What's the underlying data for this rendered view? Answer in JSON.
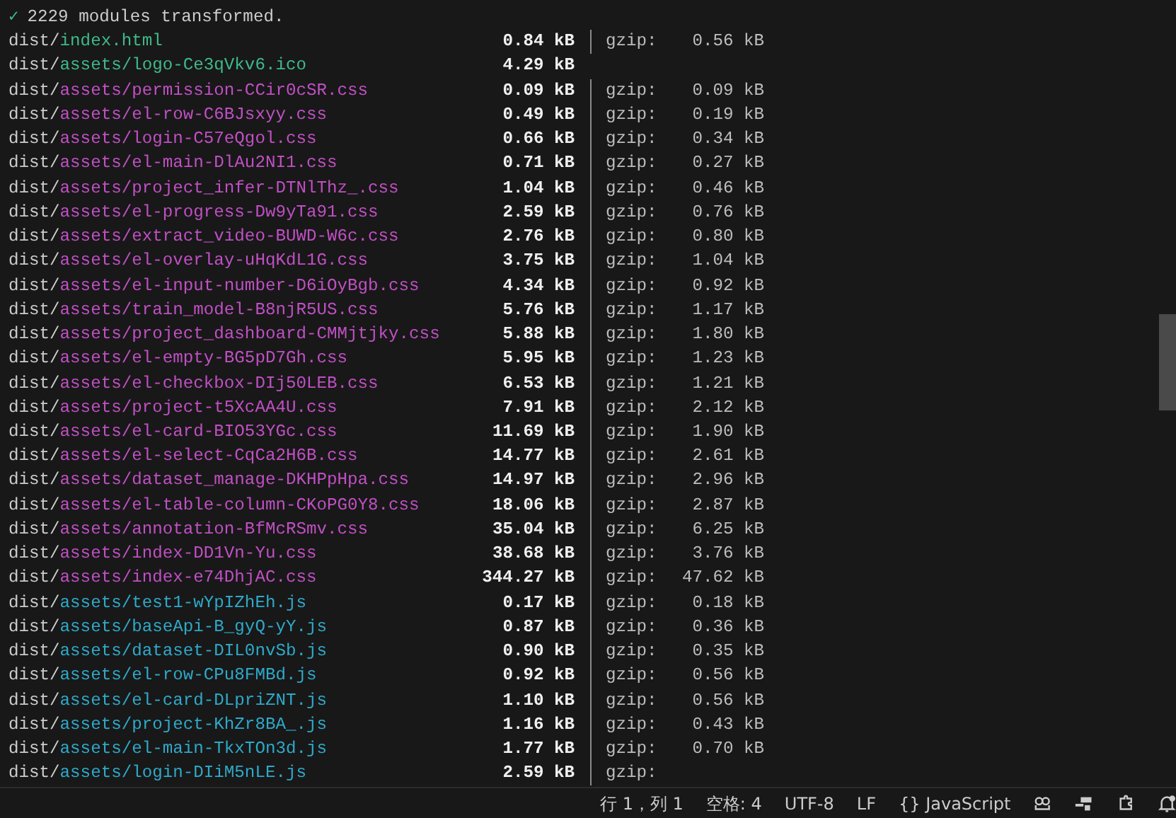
{
  "terminal": {
    "summary": {
      "check": "✓",
      "text": "2229 modules transformed."
    },
    "rows": [
      {
        "dir": "dist/",
        "file": "index.html",
        "kind": "html",
        "size": "0.84 kB",
        "gzip_label": "gzip:",
        "gzip": "0.56 kB"
      },
      {
        "dir": "dist/",
        "file": "assets/logo-Ce3qVkv6.ico",
        "kind": "ico",
        "size": "4.29 kB"
      },
      {
        "dir": "dist/",
        "file": "assets/permission-CCir0cSR.css",
        "kind": "css",
        "size": "0.09 kB",
        "gzip_label": "gzip:",
        "gzip": "0.09 kB"
      },
      {
        "dir": "dist/",
        "file": "assets/el-row-C6BJsxyy.css",
        "kind": "css",
        "size": "0.49 kB",
        "gzip_label": "gzip:",
        "gzip": "0.19 kB"
      },
      {
        "dir": "dist/",
        "file": "assets/login-C57eQgol.css",
        "kind": "css",
        "size": "0.66 kB",
        "gzip_label": "gzip:",
        "gzip": "0.34 kB"
      },
      {
        "dir": "dist/",
        "file": "assets/el-main-DlAu2NI1.css",
        "kind": "css",
        "size": "0.71 kB",
        "gzip_label": "gzip:",
        "gzip": "0.27 kB"
      },
      {
        "dir": "dist/",
        "file": "assets/project_infer-DTNlThz_.css",
        "kind": "css",
        "size": "1.04 kB",
        "gzip_label": "gzip:",
        "gzip": "0.46 kB"
      },
      {
        "dir": "dist/",
        "file": "assets/el-progress-Dw9yTa91.css",
        "kind": "css",
        "size": "2.59 kB",
        "gzip_label": "gzip:",
        "gzip": "0.76 kB"
      },
      {
        "dir": "dist/",
        "file": "assets/extract_video-BUWD-W6c.css",
        "kind": "css",
        "size": "2.76 kB",
        "gzip_label": "gzip:",
        "gzip": "0.80 kB"
      },
      {
        "dir": "dist/",
        "file": "assets/el-overlay-uHqKdL1G.css",
        "kind": "css",
        "size": "3.75 kB",
        "gzip_label": "gzip:",
        "gzip": "1.04 kB"
      },
      {
        "dir": "dist/",
        "file": "assets/el-input-number-D6iOyBgb.css",
        "kind": "css",
        "size": "4.34 kB",
        "gzip_label": "gzip:",
        "gzip": "0.92 kB"
      },
      {
        "dir": "dist/",
        "file": "assets/train_model-B8njR5US.css",
        "kind": "css",
        "size": "5.76 kB",
        "gzip_label": "gzip:",
        "gzip": "1.17 kB"
      },
      {
        "dir": "dist/",
        "file": "assets/project_dashboard-CMMjtjky.css",
        "kind": "css",
        "size": "5.88 kB",
        "gzip_label": "gzip:",
        "gzip": "1.80 kB"
      },
      {
        "dir": "dist/",
        "file": "assets/el-empty-BG5pD7Gh.css",
        "kind": "css",
        "size": "5.95 kB",
        "gzip_label": "gzip:",
        "gzip": "1.23 kB"
      },
      {
        "dir": "dist/",
        "file": "assets/el-checkbox-DIj50LEB.css",
        "kind": "css",
        "size": "6.53 kB",
        "gzip_label": "gzip:",
        "gzip": "1.21 kB"
      },
      {
        "dir": "dist/",
        "file": "assets/project-t5XcAA4U.css",
        "kind": "css",
        "size": "7.91 kB",
        "gzip_label": "gzip:",
        "gzip": "2.12 kB"
      },
      {
        "dir": "dist/",
        "file": "assets/el-card-BIO53YGc.css",
        "kind": "css",
        "size": "11.69 kB",
        "gzip_label": "gzip:",
        "gzip": "1.90 kB"
      },
      {
        "dir": "dist/",
        "file": "assets/el-select-CqCa2H6B.css",
        "kind": "css",
        "size": "14.77 kB",
        "gzip_label": "gzip:",
        "gzip": "2.61 kB"
      },
      {
        "dir": "dist/",
        "file": "assets/dataset_manage-DKHPpHpa.css",
        "kind": "css",
        "size": "14.97 kB",
        "gzip_label": "gzip:",
        "gzip": "2.96 kB"
      },
      {
        "dir": "dist/",
        "file": "assets/el-table-column-CKoPG0Y8.css",
        "kind": "css",
        "size": "18.06 kB",
        "gzip_label": "gzip:",
        "gzip": "2.87 kB"
      },
      {
        "dir": "dist/",
        "file": "assets/annotation-BfMcRSmv.css",
        "kind": "css",
        "size": "35.04 kB",
        "gzip_label": "gzip:",
        "gzip": "6.25 kB"
      },
      {
        "dir": "dist/",
        "file": "assets/index-DD1Vn-Yu.css",
        "kind": "css",
        "size": "38.68 kB",
        "gzip_label": "gzip:",
        "gzip": "3.76 kB"
      },
      {
        "dir": "dist/",
        "file": "assets/index-e74DhjAC.css",
        "kind": "css",
        "size": "344.27 kB",
        "gzip_label": "gzip:",
        "gzip": "47.62 kB"
      },
      {
        "dir": "dist/",
        "file": "assets/test1-wYpIZhEh.js",
        "kind": "js",
        "size": "0.17 kB",
        "gzip_label": "gzip:",
        "gzip": "0.18 kB"
      },
      {
        "dir": "dist/",
        "file": "assets/baseApi-B_gyQ-yY.js",
        "kind": "js",
        "size": "0.87 kB",
        "gzip_label": "gzip:",
        "gzip": "0.36 kB"
      },
      {
        "dir": "dist/",
        "file": "assets/dataset-DIL0nvSb.js",
        "kind": "js",
        "size": "0.90 kB",
        "gzip_label": "gzip:",
        "gzip": "0.35 kB"
      },
      {
        "dir": "dist/",
        "file": "assets/el-row-CPu8FMBd.js",
        "kind": "js",
        "size": "0.92 kB",
        "gzip_label": "gzip:",
        "gzip": "0.56 kB"
      },
      {
        "dir": "dist/",
        "file": "assets/el-card-DLpriZNT.js",
        "kind": "js",
        "size": "1.10 kB",
        "gzip_label": "gzip:",
        "gzip": "0.56 kB"
      },
      {
        "dir": "dist/",
        "file": "assets/project-KhZr8BA_.js",
        "kind": "js",
        "size": "1.16 kB",
        "gzip_label": "gzip:",
        "gzip": "0.43 kB"
      },
      {
        "dir": "dist/",
        "file": "assets/el-main-TkxTOn3d.js",
        "kind": "js",
        "size": "1.77 kB",
        "gzip_label": "gzip:",
        "gzip": "0.70 kB"
      },
      {
        "dir": "dist/",
        "file": "assets/login-DIiM5nLE.js",
        "kind": "js",
        "size": "2.59 kB",
        "gzip_label": "gzip:"
      }
    ]
  },
  "status_bar": {
    "items": [
      "行 1，列 1",
      "空格: 4",
      "UTF-8",
      "LF",
      "{} JavaScript"
    ],
    "icons": [
      {
        "kind": "robot"
      },
      {
        "kind": "ports"
      },
      {
        "kind": "puzzle"
      },
      {
        "kind": "bell"
      }
    ]
  }
}
